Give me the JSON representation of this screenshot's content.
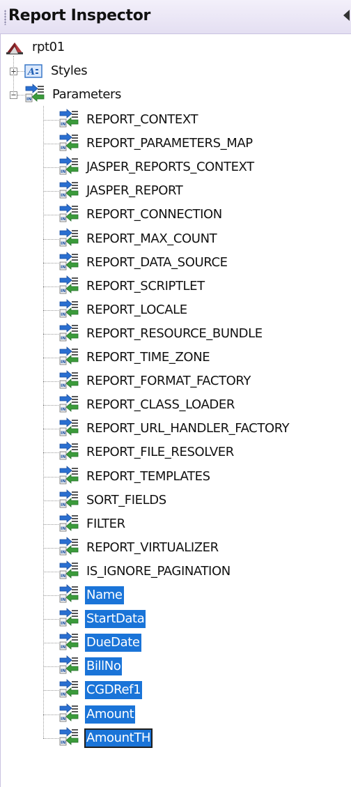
{
  "panel": {
    "title": "Report Inspector",
    "root_label": "rpt01",
    "styles_label": "Styles",
    "parameters_label": "Parameters",
    "expander_expanded": "−",
    "expander_collapsed": "+"
  },
  "parameters": [
    {
      "label": "REPORT_CONTEXT",
      "selected": false
    },
    {
      "label": "REPORT_PARAMETERS_MAP",
      "selected": false
    },
    {
      "label": "JASPER_REPORTS_CONTEXT",
      "selected": false
    },
    {
      "label": "JASPER_REPORT",
      "selected": false
    },
    {
      "label": "REPORT_CONNECTION",
      "selected": false
    },
    {
      "label": "REPORT_MAX_COUNT",
      "selected": false
    },
    {
      "label": "REPORT_DATA_SOURCE",
      "selected": false
    },
    {
      "label": "REPORT_SCRIPTLET",
      "selected": false
    },
    {
      "label": "REPORT_LOCALE",
      "selected": false
    },
    {
      "label": "REPORT_RESOURCE_BUNDLE",
      "selected": false
    },
    {
      "label": "REPORT_TIME_ZONE",
      "selected": false
    },
    {
      "label": "REPORT_FORMAT_FACTORY",
      "selected": false
    },
    {
      "label": "REPORT_CLASS_LOADER",
      "selected": false
    },
    {
      "label": "REPORT_URL_HANDLER_FACTORY",
      "selected": false
    },
    {
      "label": "REPORT_FILE_RESOLVER",
      "selected": false
    },
    {
      "label": "REPORT_TEMPLATES",
      "selected": false
    },
    {
      "label": "SORT_FIELDS",
      "selected": false
    },
    {
      "label": "FILTER",
      "selected": false
    },
    {
      "label": "REPORT_VIRTUALIZER",
      "selected": false
    },
    {
      "label": "IS_IGNORE_PAGINATION",
      "selected": false
    },
    {
      "label": "Name",
      "selected": true
    },
    {
      "label": "StartData",
      "selected": true
    },
    {
      "label": "DueDate",
      "selected": true
    },
    {
      "label": "BillNo",
      "selected": true
    },
    {
      "label": "CGDRef1",
      "selected": true
    },
    {
      "label": "Amount",
      "selected": true
    },
    {
      "label": "AmountTH",
      "selected": true,
      "focused": true
    }
  ],
  "colors": {
    "selection": "#1a74d8",
    "icon_blue": "#2a6fd0",
    "icon_green": "#3b9b3b",
    "report_icon": "#7b1f23"
  },
  "icons": {
    "root": "report-icon",
    "styles": "styles-icon",
    "parameters": "parameters-icon",
    "parameter": "parameter-icon"
  }
}
